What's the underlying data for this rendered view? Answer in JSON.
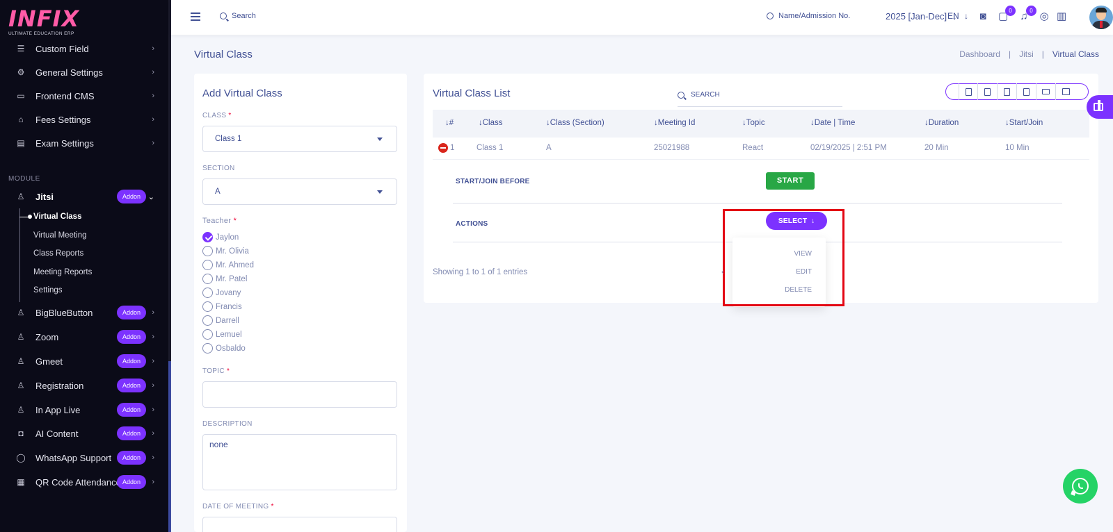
{
  "logo": {
    "text": "INFIX",
    "subtitle": "ULTIMATE EDUCATION ERP"
  },
  "sidebar": {
    "items": [
      {
        "label": "Custom Field",
        "icon": "custom-field-icon"
      },
      {
        "label": "General Settings",
        "icon": "gears-icon"
      },
      {
        "label": "Frontend CMS",
        "icon": "cms-icon"
      },
      {
        "label": "Fees Settings",
        "icon": "bank-icon"
      },
      {
        "label": "Exam Settings",
        "icon": "exam-icon"
      }
    ],
    "module_label": "MODULE",
    "modules": [
      {
        "label": "Jitsi",
        "badge": "Addon",
        "icon": "person-icon"
      },
      {
        "label": "BigBlueButton",
        "badge": "Addon",
        "icon": "person-icon"
      },
      {
        "label": "Zoom",
        "badge": "Addon",
        "icon": "person-icon"
      },
      {
        "label": "Gmeet",
        "badge": "Addon",
        "icon": "person-icon"
      },
      {
        "label": "Registration",
        "badge": "Addon",
        "icon": "person-icon"
      },
      {
        "label": "In App Live",
        "badge": "Addon",
        "icon": "person-icon"
      },
      {
        "label": "AI Content",
        "badge": "Addon",
        "icon": "robot-icon"
      },
      {
        "label": "WhatsApp Support",
        "badge": "Addon",
        "icon": "whatsapp-icon"
      },
      {
        "label": "QR Code Attendance",
        "badge": "Addon",
        "icon": "qr-icon"
      }
    ],
    "jitsi_sub": [
      "Virtual Class",
      "Virtual Meeting",
      "Class Reports",
      "Meeting Reports",
      "Settings"
    ]
  },
  "header": {
    "search_label": "Search",
    "admission_search": "Name/Admission No.",
    "year": "2025 [Jan-Dec]",
    "lang": "EN",
    "chat_badge": "0",
    "notify_badge": "0"
  },
  "page": {
    "title": "Virtual Class",
    "breadcrumb": [
      "Dashboard",
      "Jitsi",
      "Virtual Class"
    ],
    "separator": "|"
  },
  "form": {
    "title": "Add Virtual Class",
    "class_label": "CLASS",
    "class_value": "Class 1",
    "section_label": "SECTION",
    "section_value": "A",
    "teacher_label": "Teacher",
    "teachers": [
      "Jaylon",
      "Mr. Olivia",
      "Mr. Ahmed",
      "Mr. Patel",
      "Jovany",
      "Francis",
      "Darrell",
      "Lemuel",
      "Osbaldo"
    ],
    "teacher_checked": "Jaylon",
    "topic_label": "TOPIC",
    "topic_value": "",
    "description_label": "DESCRIPTION",
    "description_value": "none",
    "date_label": "DATE OF MEETING",
    "required_mark": "*"
  },
  "list": {
    "title": "Virtual Class List",
    "search_placeholder": "SEARCH",
    "export_icons": [
      "copy-icon",
      "excel-icon",
      "csv-icon",
      "pdf-icon",
      "print-icon",
      "columns-icon"
    ],
    "columns": [
      "#",
      "Class",
      "Class (Section)",
      "Meeting Id",
      "Topic",
      "Date | Time",
      "Duration",
      "Start/Join"
    ],
    "rows": [
      {
        "num": "1",
        "class": "Class 1",
        "section": "A",
        "meeting_id": "25021988",
        "topic": "React",
        "datetime": "02/19/2025 | 2:51 PM",
        "duration": "20 Min",
        "start_join": "10 Min"
      }
    ],
    "detail": {
      "start_join_label": "START/JOIN BEFORE",
      "start_button": "START",
      "actions_label": "ACTIONS",
      "select_button": "SELECT",
      "dropdown": [
        "VIEW",
        "EDIT",
        "DELETE"
      ]
    },
    "showing": "Showing 1 to 1 of 1 entries"
  },
  "colors": {
    "accent": "#7c32ff",
    "start": "#28a745",
    "highlight": "#e30613",
    "text": "#415094"
  }
}
